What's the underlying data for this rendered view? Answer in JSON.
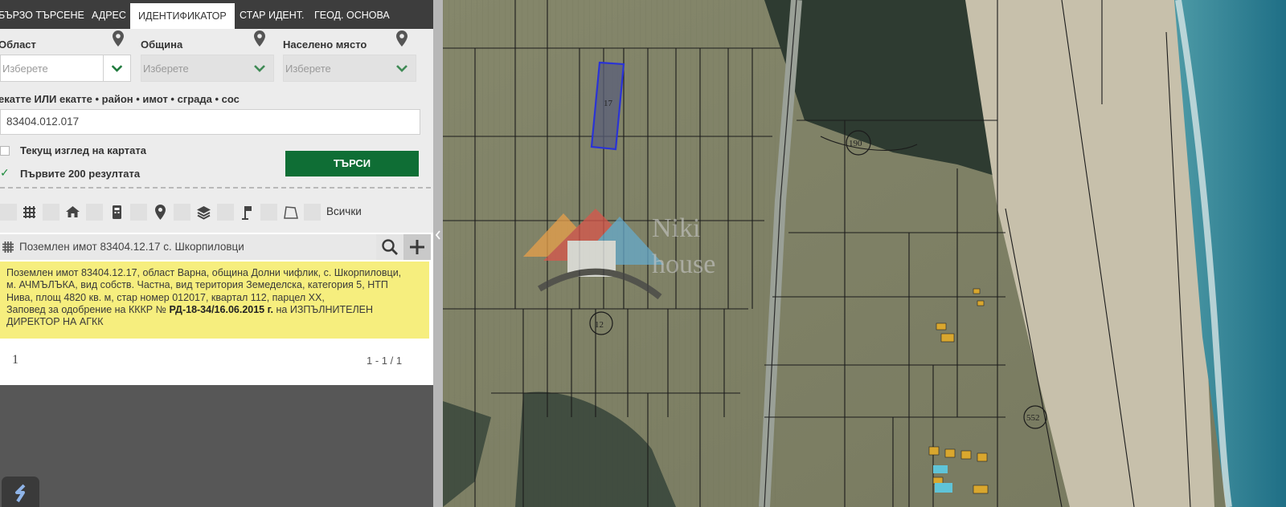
{
  "tabs": [
    {
      "label": "БЪРЗО ТЪРСЕНЕ"
    },
    {
      "label": "АДРЕС"
    },
    {
      "label": "ИДЕНТИФИКАТОР"
    },
    {
      "label": "СТАР ИДЕНТ."
    },
    {
      "label": "ГЕОД. ОСНОВА"
    }
  ],
  "filters": {
    "oblast": {
      "label": "Област",
      "placeholder": "Изберете"
    },
    "obshtina": {
      "label": "Община",
      "placeholder": "Изберете"
    },
    "naseleno": {
      "label": "Населено място",
      "placeholder": "Изберете"
    }
  },
  "identifier": {
    "label": "екатте ИЛИ екатте • район • имот • сграда • сос",
    "value": "83404.012.017"
  },
  "options": {
    "current_view": "Текущ изглед на картата",
    "first_200": "Първите 200 резултата",
    "first_200_checked": true
  },
  "search_button": "ТЪРСИ",
  "type_filters": {
    "all_label": "Всички",
    "icons": [
      "grid-icon",
      "home-icon",
      "building-icon",
      "location-pin-icon",
      "layers-icon",
      "flag-icon",
      "polygon-icon"
    ]
  },
  "result": {
    "title": "Поземлен имот 83404.12.17 с. Шкорпиловци",
    "line1": "Поземлен имот 83404.12.17, област Варна, община Долни чифлик, с. Шкорпиловци,",
    "line2": "м. АЧМЪЛЪКА, вид собств. Частна, вид територия Земеделска, категория 5, НТП",
    "line3": "Нива, площ 4820 кв. м, стар номер 012017, квартал 112, парцел XX,",
    "line4a": "Заповед за одобрение на КККР №",
    "line4b": "РД-18-34/16.06.2015 г.",
    "line4c": "на ИЗПЪЛНИТЕЛЕН",
    "line5": "ДИРЕКТОР НА АГКК"
  },
  "pagination": {
    "page": "1",
    "range": "1 - 1 / 1"
  },
  "map": {
    "watermark_line1": "Niki",
    "watermark_line2": "house",
    "selected_parcel": "17",
    "quarter_labels": [
      "190",
      "12",
      "552"
    ],
    "colors": {
      "selected": "#2a33d6",
      "accent": "#0f6e35",
      "result_bg": "#f6ee7e"
    }
  }
}
